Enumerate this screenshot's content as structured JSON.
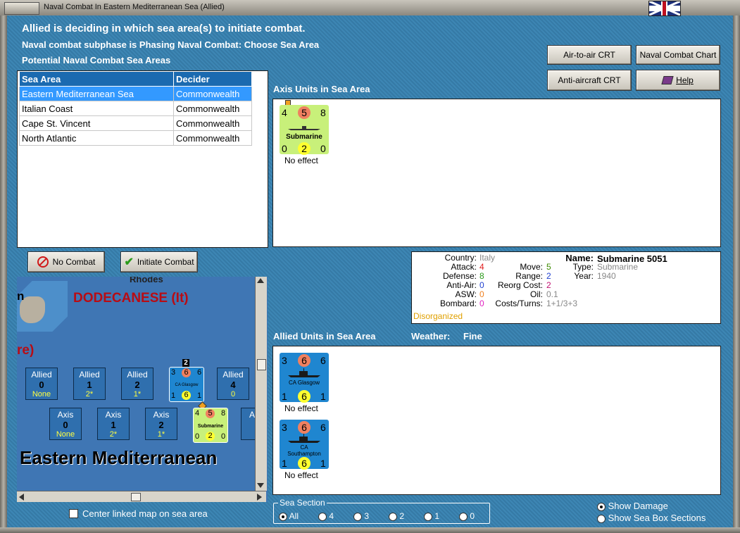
{
  "window": {
    "title": "Naval Combat In Eastern Mediterranean Sea (Allied)"
  },
  "header": {
    "line1": "Allied is deciding in which sea area(s) to initiate combat.",
    "line2": "Naval combat subphase is Phasing Naval Combat: Choose Sea Area",
    "line3": "Potential Naval Combat Sea Areas"
  },
  "buttons": {
    "air_to_air": "Air-to-air CRT",
    "naval_chart": "Naval Combat Chart",
    "anti_aircraft": "Anti-aircraft CRT",
    "help": "Help",
    "no_combat": "No Combat",
    "initiate": "Initiate Combat"
  },
  "sea_table": {
    "headers": [
      "Sea Area",
      "Decider"
    ],
    "rows": [
      [
        "Eastern Mediterranean Sea",
        "Commonwealth"
      ],
      [
        "Italian Coast",
        "Commonwealth"
      ],
      [
        "Cape St. Vincent",
        "Commonwealth"
      ],
      [
        "North Atlantic",
        "Commonwealth"
      ]
    ]
  },
  "axis_section": {
    "label": "Axis Units in Sea Area",
    "unit": {
      "top_left": "4",
      "top_mid": "5",
      "top_right": "8",
      "name": "Submarine",
      "bot_left": "0",
      "bot_mid": "2",
      "bot_right": "0",
      "status": "No effect"
    }
  },
  "info": {
    "country_label": "Country:",
    "country": "Italy",
    "attack_label": "Attack:",
    "attack": "4",
    "defense_label": "Defense:",
    "defense": "8",
    "antiair_label": "Anti-Air:",
    "antiair": "0",
    "asw_label": "ASW:",
    "asw": "0",
    "bombard_label": "Bombard:",
    "bombard": "0",
    "status": "Disorganized",
    "move_label": "Move:",
    "move": "5",
    "range_label": "Range:",
    "range": "2",
    "reorg_label": "Reorg Cost:",
    "reorg": "2",
    "oil_label": "Oil:",
    "oil": "0.1",
    "costs_label": "Costs/Turns:",
    "costs": "1+1/3+3",
    "name_label": "Name:",
    "name": "Submarine 5051",
    "type_label": "Type:",
    "type": "Submarine",
    "year_label": "Year:",
    "year": "1940"
  },
  "allied_section": {
    "label": "Allied Units in Sea Area",
    "weather_label": "Weather:",
    "weather": "Fine",
    "units": [
      {
        "top_left": "3",
        "top_mid": "6",
        "top_right": "6",
        "name": "CA Glasgow",
        "bot_left": "1",
        "bot_mid": "6",
        "bot_right": "1",
        "status": "No effect"
      },
      {
        "top_left": "3",
        "top_mid": "6",
        "top_right": "6",
        "name": "CA Southampton",
        "bot_left": "1",
        "bot_mid": "6",
        "bot_right": "1",
        "status": "No effect"
      }
    ]
  },
  "map": {
    "region": "DODECANESE (It)",
    "rhodes": "Rhodes",
    "left_n": "n",
    "left_re": "re)",
    "sea_name": "Eastern Mediterranean",
    "stack_count": "2",
    "allied_boxes": [
      {
        "side": "Allied",
        "num": "0",
        "sub": "None"
      },
      {
        "side": "Allied",
        "num": "1",
        "sub": "2*"
      },
      {
        "side": "Allied",
        "num": "2",
        "sub": "1*"
      },
      {
        "side": "Allied",
        "num": "4",
        "sub": "0"
      }
    ],
    "axis_boxes": [
      {
        "side": "Axis",
        "num": "0",
        "sub": "None"
      },
      {
        "side": "Axis",
        "num": "1",
        "sub": "2*"
      },
      {
        "side": "Axis",
        "num": "2",
        "sub": "1*"
      },
      {
        "side": "A"
      }
    ],
    "map_allied_unit": {
      "tl": "3",
      "tm": "6",
      "tr": "6",
      "name": "CA Glasgow",
      "bl": "1",
      "bm": "6",
      "br": "1"
    },
    "map_axis_unit": {
      "tl": "4",
      "tm": "5",
      "tr": "8",
      "name": "Submarine",
      "bl": "0",
      "bm": "2",
      "br": "0"
    }
  },
  "center_map_label": "Center linked map on sea area",
  "sea_section": {
    "label": "Sea Section",
    "options": [
      "All",
      "4",
      "3",
      "2",
      "1",
      "0"
    ]
  },
  "show_damage": "Show Damage",
  "show_sections": "Show Sea Box Sections",
  "colors": {
    "accent": "#1b6ab0",
    "selection": "#3399ff",
    "counter_green": "#c8f07a",
    "counter_blue": "#1f86d0"
  }
}
